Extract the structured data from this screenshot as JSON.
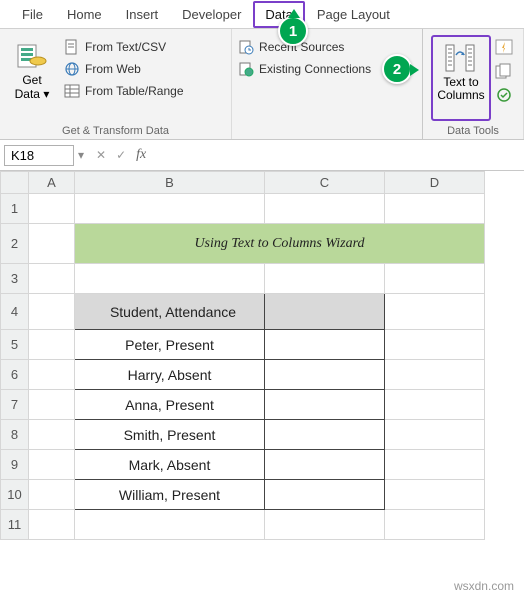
{
  "tabs": {
    "file": "File",
    "home": "Home",
    "insert": "Insert",
    "developer": "Developer",
    "data": "Data",
    "page_layout": "Page Layout"
  },
  "ribbon": {
    "get_data": "Get\nData",
    "from_text_csv": "From Text/CSV",
    "from_web": "From Web",
    "from_table": "From Table/Range",
    "recent_sources": "Recent Sources",
    "existing_conn": "Existing Connections",
    "group1": "Get & Transform Data",
    "text_to_columns": "Text to\nColumns",
    "group2": "Data Tools"
  },
  "callouts": {
    "one": "1",
    "two": "2"
  },
  "namebox": "K18",
  "cols": {
    "A": "A",
    "B": "B",
    "C": "C",
    "D": "D"
  },
  "rows": [
    "1",
    "2",
    "3",
    "4",
    "5",
    "6",
    "7",
    "8",
    "9",
    "10",
    "11"
  ],
  "sheet": {
    "title": "Using Text to Columns Wizard",
    "header": "Student, Attendance",
    "r5": "Peter, Present",
    "r6": "Harry, Absent",
    "r7": "Anna, Present",
    "r8": "Smith, Present",
    "r9": "Mark, Absent",
    "r10": "William, Present"
  },
  "watermark": "wsxdn.com",
  "chart_data": {
    "type": "table",
    "title": "Using Text to Columns Wizard",
    "columns": [
      "Student, Attendance"
    ],
    "rows": [
      [
        "Peter, Present"
      ],
      [
        "Harry, Absent"
      ],
      [
        "Anna, Present"
      ],
      [
        "Smith, Present"
      ],
      [
        "Mark, Absent"
      ],
      [
        "William, Present"
      ]
    ]
  }
}
